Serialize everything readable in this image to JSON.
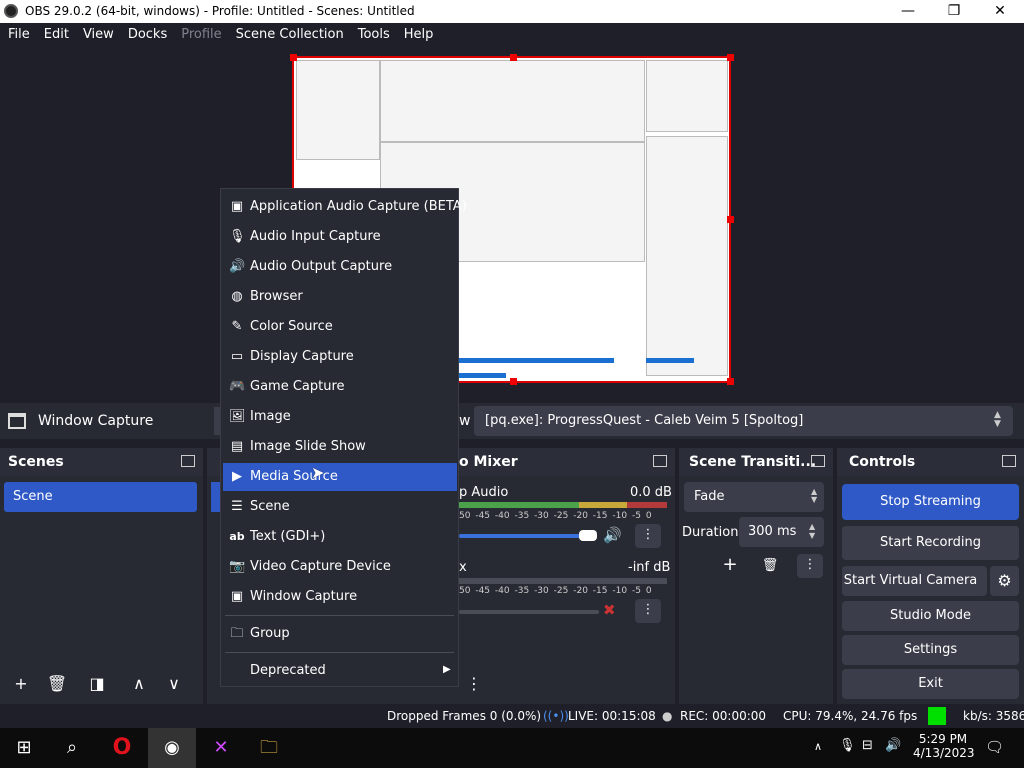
{
  "window": {
    "title": "OBS 29.0.2 (64-bit, windows) - Profile: Untitled - Scenes: Untitled",
    "minimize_icon": "—",
    "maximize_icon": "❐",
    "close_icon": "✕"
  },
  "menubar": [
    "File",
    "Edit",
    "View",
    "Docks",
    "Profile",
    "Scene Collection",
    "Tools",
    "Help"
  ],
  "source_bar": {
    "source_name": "Window Capture",
    "window_label_fragment": "w",
    "window_value": "[pq.exe]: ProgressQuest - Caleb Veim 5 [Spoltog]"
  },
  "scenes": {
    "title": "Scenes",
    "items": [
      "Scene"
    ]
  },
  "audio_mixer": {
    "title_fragment": "o Mixer",
    "channels": [
      {
        "name_fragment": "p Audio",
        "level": "0.0 dB"
      },
      {
        "name_fragment": "x",
        "level": "-inf dB"
      }
    ],
    "scale": [
      "50",
      "-45",
      "-40",
      "-35",
      "-30",
      "-25",
      "-20",
      "-15",
      "-10",
      "-5",
      "0"
    ]
  },
  "transitions": {
    "title": "Scene Transiti...",
    "selected": "Fade",
    "duration_label": "Duration",
    "duration_value": "300 ms"
  },
  "controls": {
    "title": "Controls",
    "stop_streaming": "Stop Streaming",
    "start_recording": "Start Recording",
    "start_virtual_camera": "Start Virtual Camera",
    "studio_mode": "Studio Mode",
    "settings": "Settings",
    "exit": "Exit"
  },
  "context_menu": {
    "items": [
      {
        "label": "Application Audio Capture (BETA)",
        "icon": "app-audio-icon"
      },
      {
        "label": "Audio Input Capture",
        "icon": "microphone-icon"
      },
      {
        "label": "Audio Output Capture",
        "icon": "speaker-icon"
      },
      {
        "label": "Browser",
        "icon": "globe-icon"
      },
      {
        "label": "Color Source",
        "icon": "brush-icon"
      },
      {
        "label": "Display Capture",
        "icon": "monitor-icon"
      },
      {
        "label": "Game Capture",
        "icon": "gamepad-icon"
      },
      {
        "label": "Image",
        "icon": "image-icon"
      },
      {
        "label": "Image Slide Show",
        "icon": "slideshow-icon"
      },
      {
        "label": "Media Source",
        "icon": "play-icon"
      },
      {
        "label": "Scene",
        "icon": "list-icon"
      },
      {
        "label": "Text (GDI+)",
        "icon": "text-icon"
      },
      {
        "label": "Video Capture Device",
        "icon": "camera-icon"
      },
      {
        "label": "Window Capture",
        "icon": "window-icon"
      }
    ],
    "group": "Group",
    "deprecated": "Deprecated",
    "selected_index": 9
  },
  "statusbar": {
    "dropped": "Dropped Frames 0 (0.0%)",
    "live": "LIVE: 00:15:08",
    "rec": "REC: 00:00:00",
    "cpu": "CPU: 79.4%, 24.76 fps",
    "kbs": "kb/s: 3586"
  },
  "taskbar": {
    "time": "5:29 PM",
    "date": "4/13/2023"
  },
  "colors": {
    "accent": "#2e59c7",
    "live_indicator": "#00e000",
    "recording_red": "#dd0000"
  }
}
